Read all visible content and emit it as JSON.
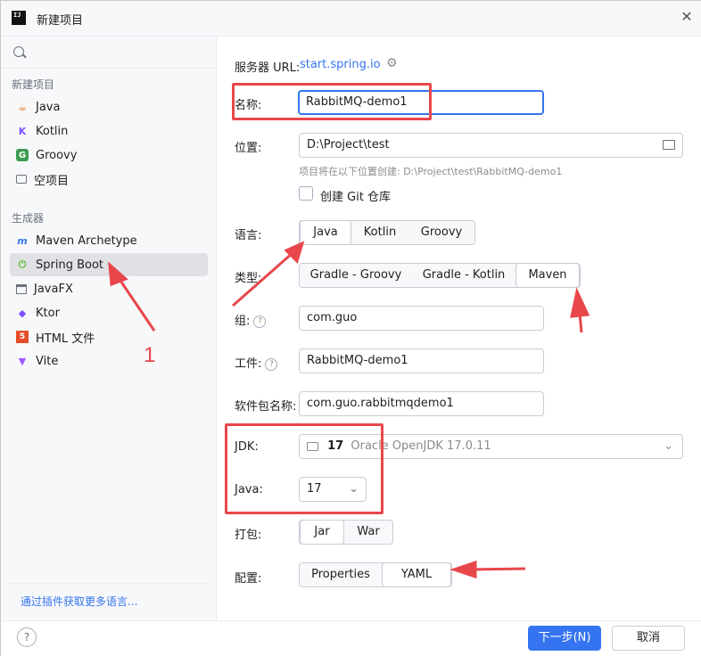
{
  "window": {
    "title": "新建项目",
    "app_icon_text": "IJ"
  },
  "sidebar": {
    "search_placeholder": "",
    "section_new_project": "新建项目",
    "new_items": [
      {
        "label": "Java",
        "icon": "java-cup-icon"
      },
      {
        "label": "Kotlin",
        "icon": "kotlin-icon"
      },
      {
        "label": "Groovy",
        "icon": "groovy-icon"
      },
      {
        "label": "空项目",
        "icon": "empty-project-icon"
      }
    ],
    "section_generators": "生成器",
    "generator_items": [
      {
        "label": "Maven Archetype",
        "icon": "maven-icon"
      },
      {
        "label": "Spring Boot",
        "icon": "spring-boot-icon",
        "selected": true
      },
      {
        "label": "JavaFX",
        "icon": "javafx-icon"
      },
      {
        "label": "Ktor",
        "icon": "ktor-icon"
      },
      {
        "label": "HTML 文件",
        "icon": "html5-icon"
      },
      {
        "label": "Vite",
        "icon": "vite-icon"
      }
    ],
    "plugin_link": "通过插件获取更多语言..."
  },
  "form": {
    "server_url_label": "服务器 URL:",
    "server_url_value": "start.spring.io",
    "name_label": "名称:",
    "name_value": "RabbitMQ-demo1",
    "location_label": "位置:",
    "location_value": "D:\\Project\\test",
    "location_hint": "项目将在以下位置创建: D:\\Project\\test\\RabbitMQ-demo1",
    "git_label": "创建 Git 仓库",
    "language_label": "语言:",
    "languages": [
      "Java",
      "Kotlin",
      "Groovy"
    ],
    "type_label": "类型:",
    "types": [
      "Gradle - Groovy",
      "Gradle - Kotlin",
      "Maven"
    ],
    "group_label": "组:",
    "group_value": "com.guo",
    "artifact_label": "工件:",
    "artifact_value": "RabbitMQ-demo1",
    "package_label": "软件包名称:",
    "package_value": "com.guo.rabbitmqdemo1",
    "jdk_label": "JDK:",
    "jdk_version": "17",
    "jdk_name": "Oracle OpenJDK 17.0.11",
    "java_label": "Java:",
    "java_value": "17",
    "packaging_label": "打包:",
    "packagings": [
      "Jar",
      "War"
    ],
    "config_label": "配置:",
    "configs": [
      "Properties",
      "YAML"
    ]
  },
  "footer": {
    "help": "?",
    "next_label": "下一步(N)",
    "cancel_label": "取消"
  },
  "annotation": {
    "number": "1",
    "color": "#e8474b"
  }
}
